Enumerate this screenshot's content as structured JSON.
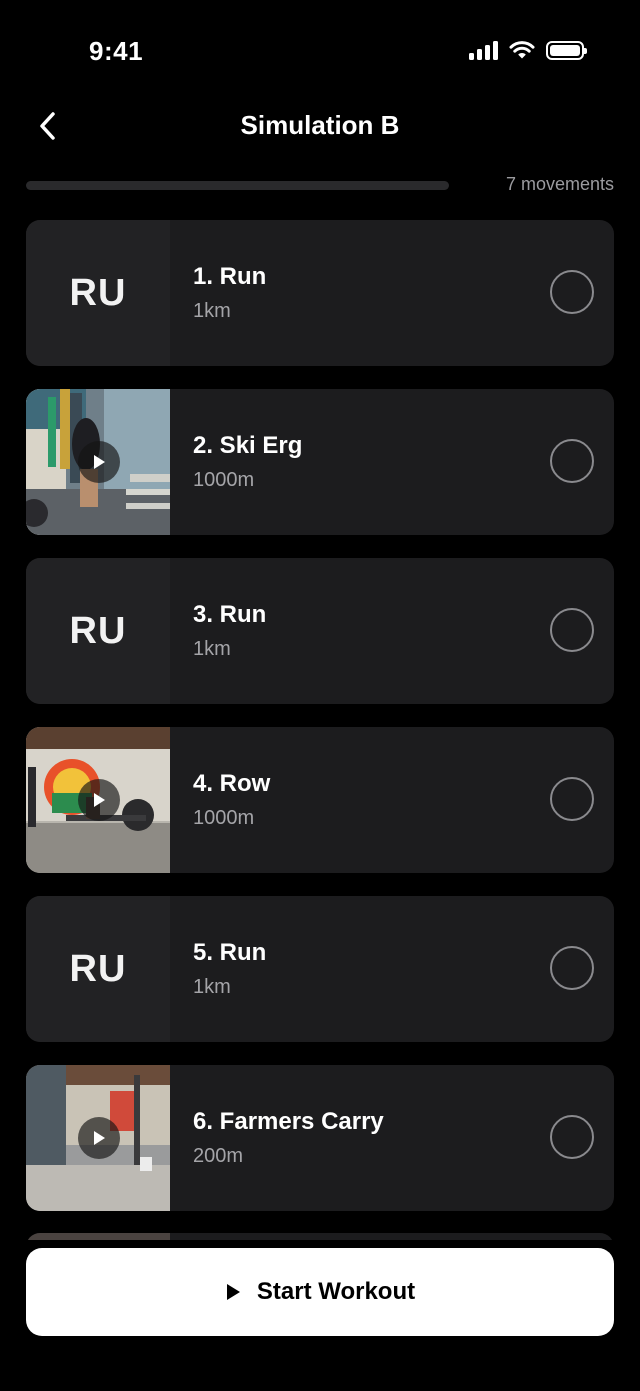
{
  "status_bar": {
    "time": "9:41"
  },
  "header": {
    "title": "Simulation B"
  },
  "progress": {
    "fraction": 0.0,
    "label": "7 movements"
  },
  "movements": [
    {
      "title": "1. Run",
      "subtitle": "1km",
      "thumb_type": "text",
      "thumb_text": "RU"
    },
    {
      "title": "2. Ski Erg",
      "subtitle": "1000m",
      "thumb_type": "video"
    },
    {
      "title": "3. Run",
      "subtitle": "1km",
      "thumb_type": "text",
      "thumb_text": "RU"
    },
    {
      "title": "4. Row",
      "subtitle": "1000m",
      "thumb_type": "video"
    },
    {
      "title": "5. Run",
      "subtitle": "1km",
      "thumb_type": "text",
      "thumb_text": "RU"
    },
    {
      "title": "6. Farmers Carry",
      "subtitle": "200m",
      "thumb_type": "video"
    }
  ],
  "footer": {
    "start_label": "Start Workout"
  },
  "colors": {
    "background": "#000000",
    "card": "#1c1c1e",
    "accent_button": "#ffffff",
    "muted_text": "#a4a4a8"
  }
}
